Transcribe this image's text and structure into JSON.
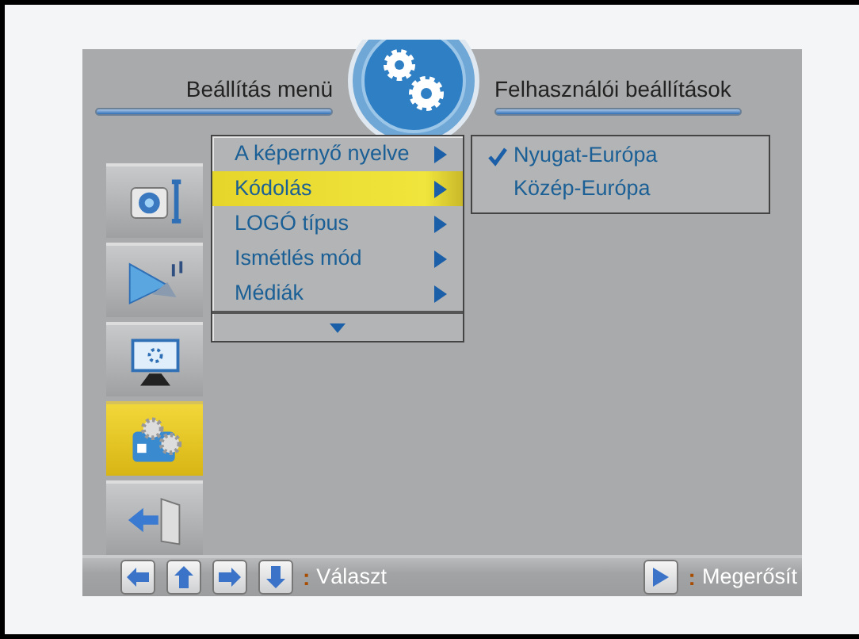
{
  "header": {
    "left_title": "Beállítás menü",
    "right_title": "Felhasználói beállítások"
  },
  "sidebar": {
    "items": [
      {
        "kind": "camera-tools",
        "selected": false
      },
      {
        "kind": "picture-music",
        "selected": false
      },
      {
        "kind": "monitor",
        "selected": false
      },
      {
        "kind": "settings-folder",
        "selected": true
      },
      {
        "kind": "exit",
        "selected": false
      }
    ]
  },
  "menu": {
    "items": [
      {
        "label": "A képernyő nyelve",
        "selected": false
      },
      {
        "label": "Kódolás",
        "selected": true
      },
      {
        "label": "LOGÓ típus",
        "selected": false
      },
      {
        "label": "Ismétlés mód",
        "selected": false
      },
      {
        "label": "Médiák",
        "selected": false
      }
    ]
  },
  "submenu": {
    "items": [
      {
        "label": "Nyugat-Európa",
        "checked": true
      },
      {
        "label": "Közép-Európa",
        "checked": false
      }
    ]
  },
  "footer": {
    "select": {
      "separator": ":",
      "label": "Választ"
    },
    "confirm": {
      "separator": ":",
      "label": "Megerősít"
    }
  }
}
